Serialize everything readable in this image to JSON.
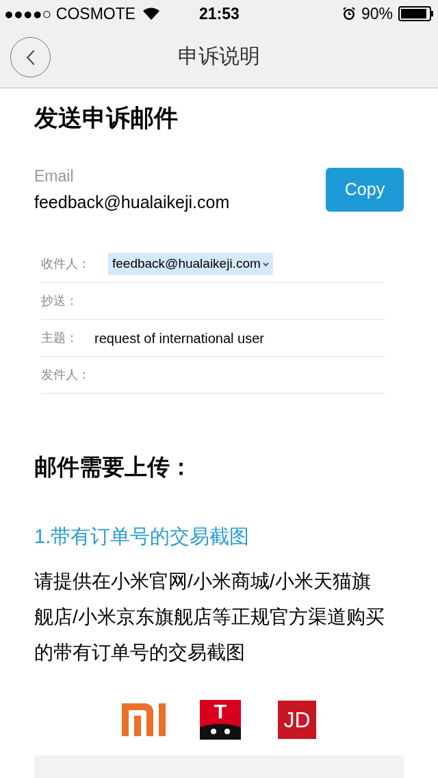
{
  "status_bar": {
    "carrier": "●●●●○ COSMOTE",
    "time": "21:53",
    "battery": "90%"
  },
  "nav": {
    "title": "申诉说明"
  },
  "heading": "发送申诉邮件",
  "email": {
    "label": "Email",
    "value": "feedback@hualaikeji.com",
    "button": "Copy"
  },
  "mail_form": [
    {
      "label": "收件人：",
      "value": "feedback@hualaikeji.com",
      "kind": "tag"
    },
    {
      "label": "抄送：",
      "kind": "empty"
    },
    {
      "label": "主题：",
      "value": "request of international user",
      "kind": "text"
    },
    {
      "label": "发件人：",
      "kind": "empty"
    }
  ],
  "upload_heading": "邮件需要上传：",
  "item_title": "1.带有订单号的交易截图",
  "item_text": "请提供在小米官网/小米商城/小米天猫旗舰店/小米京东旗舰店等正规官方渠道购买的带有订单号的交易截图",
  "logos": [
    {
      "kind": "mi"
    },
    {
      "kind": "tmall",
      "text": "T"
    },
    {
      "kind": "jd",
      "text": "JD"
    }
  ]
}
